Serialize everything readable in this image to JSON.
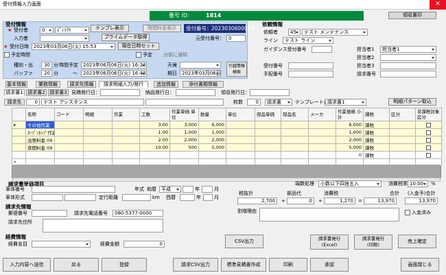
{
  "window": {
    "title": "受付情報入力画面",
    "close_symbol": "✕"
  },
  "top": {
    "badge_label": "番号 ID:",
    "badge_value": "1814",
    "right_btn": "領収書印"
  },
  "reception": {
    "header": "受付情報",
    "reception_method_label": "受付者",
    "receptor_no": "0",
    "receptor_name": "ﾃﾞｨﾃｸﾄ",
    "input_label": "入力者",
    "date_label": "受付日時",
    "date_value": "2023年03月06日(火) 15:53",
    "set_now": "現在日時セット",
    "scheduled_label": "予定時間",
    "pre_label": "予定",
    "gray_label": "分前に通知",
    "btn_tmpl": "テンプレ表示",
    "btn_time": "時間料金表示",
    "btn_primary": "プライムデータ取得",
    "rec_no_label": "受付番号：",
    "rec_no_value": "2023030600003",
    "orig_no_label": "元受付番号：",
    "orig_no_value": "0"
  },
  "schedule": {
    "kind_label": "種別・出",
    "kind_val": "30",
    "kind_unit": "分",
    "sched_label": "時間予定",
    "from": "2023年06月06日(火) 16:23",
    "buf_label": "バッファ",
    "buf_val": "20",
    "buf_unit": "分",
    "to": "2023年06月06日(火) 16:43",
    "weather_label": "天候",
    "weather_val": "",
    "due_label": "期日",
    "due_val": "2023年03月06日(火)",
    "btn_search": "引越情報\n検索",
    "dropdown": ""
  },
  "request": {
    "header": "依頼情報",
    "who_label": "依頼者",
    "who_no": "45",
    "who_name": "テスト メンテナンス",
    "line_label": "ライン",
    "line_val": "テスト ライン",
    "guide_label": "ガイダンス受付番号",
    "acc_label": "受付番号",
    "hand_label": "手配番号",
    "tanto1": "担当者1",
    "tanto1_val": "担当者1",
    "tanto2": "担当者2",
    "tanto3": "担当者3",
    "bill_label": "請求番号"
  },
  "tabs": [
    "基本情報",
    "業務情報",
    "請求先情報",
    "請求明細入力/発行",
    "追加情報",
    "添付書類情報"
  ],
  "subtabs": [
    "請求書1",
    "請求書2",
    "請求書3"
  ],
  "fields": {
    "send_label": "見積発行日：",
    "item_issue_label": "納品発行日：",
    "receipt_label": "領収発行日：",
    "bill_tab": "請求先",
    "bill_no": "0",
    "bill_name": "テスト アシスタンス",
    "count_label": "枚数",
    "count_val": "0",
    "type_label": "請求書",
    "template_label": "テンプレート選択",
    "template_val": "請求書1",
    "btn_import": "明細パターン取込"
  },
  "grid": {
    "headers": [
      "",
      "名称",
      "コード",
      "明細",
      "作業",
      "工数",
      "作業単価 単位",
      "数量",
      "単位",
      "部品単価",
      "部品名",
      "メーカ",
      "作業価格 小計",
      "課税",
      "区分",
      "非課税対象区分"
    ],
    "rows": [
      {
        "mark": "▸",
        "name": "その他作業",
        "code": "",
        "a": "",
        "b": "",
        "work": "3.00",
        "unit_price": "3,000",
        "qty": "6,000",
        "price_sub": "6,000",
        "tax": "課税",
        "kbn": "",
        "chk": false
      },
      {
        "mark": "",
        "name": "ｵｰﾌﾟﾝﾀｯﾌﾟ作業",
        "code": "",
        "a": "",
        "b": "",
        "work": "1.00",
        "unit_price": "1,000",
        "qty": "1,000",
        "price_sub": "1,000",
        "tax": "課税",
        "kbn": "",
        "chk": false
      },
      {
        "mark": "",
        "name": "出張料金 09",
        "code": "",
        "a": "",
        "b": "",
        "work": "2.00",
        "unit_price": "2,000",
        "qty": "2,000",
        "price_sub": "2,000",
        "tax": "課税",
        "kbn": "",
        "chk": false
      },
      {
        "mark": "",
        "name": "夜間料金 09",
        "code": "",
        "a": "",
        "b": "",
        "work": "10.00",
        "unit_price": "500",
        "qty": "5,000",
        "price_sub": "5,000",
        "tax": "課税",
        "kbn": "",
        "chk": false
      },
      {
        "mark": "",
        "name": "",
        "code": "",
        "a": "",
        "b": "",
        "work": "",
        "unit_price": "",
        "qty": "",
        "price_sub": "0",
        "tax": "課税",
        "kbn": "",
        "chk": false
      },
      {
        "mark": "*",
        "name": "",
        "code": "",
        "a": "",
        "b": "",
        "work": "",
        "unit_price": "",
        "qty": "",
        "price_sub": "",
        "tax": "",
        "kbn": "",
        "chk": null
      }
    ]
  },
  "invoice": {
    "header": "請求書単価項目",
    "car_type": "車体番号",
    "car_form": "車体形式",
    "car_no": "定行距離",
    "km": "km",
    "year_label": "年式",
    "era": "和暦",
    "era_val": "平成",
    "nen": "年",
    "tsuki": "月",
    "seireki": "西暦",
    "round_label": "端数処理",
    "round_val": "小数以下四捨五入",
    "tax_label": "消費税率",
    "tax_val": "10.00",
    "pct": "%",
    "tax_ex_label": "税抜計",
    "tax_ex_val": "2,700",
    "parts_label": "部品代",
    "parts_val": "0",
    "tax_amt_label": "消費税",
    "tax_amt_val": "1,270",
    "total_label": "合計",
    "total_val": "13,970",
    "total2_label": "(入金予)合計",
    "total2_val": "13,970",
    "plus": "+",
    "plus2": "+",
    "eq": "=",
    "reduce_label": "割増理由",
    "mail_label": "入金済み"
  },
  "billing": {
    "header": "請求先情報",
    "zip_label": "郵便番号",
    "tel_label": "請求先電話番号",
    "tel_val": "080-5377-0000",
    "addr_label": "請求先住所",
    "csv_btn": "CSV出力"
  },
  "payment": {
    "header": "経費情報",
    "name_label": "経費名目",
    "amt_label": "経費金額",
    "amt_val": "0"
  },
  "doc_buttons": {
    "excel": "請求書発行\n(Excel)",
    "print": "請求書発行\n(印刷)",
    "confirm": "売上確定"
  },
  "footer": [
    "入力内容へ送信",
    "戻る",
    "登録",
    "請求CSV出力",
    "標準見積書作成",
    "印刷",
    "承認",
    "画面閉じる"
  ]
}
